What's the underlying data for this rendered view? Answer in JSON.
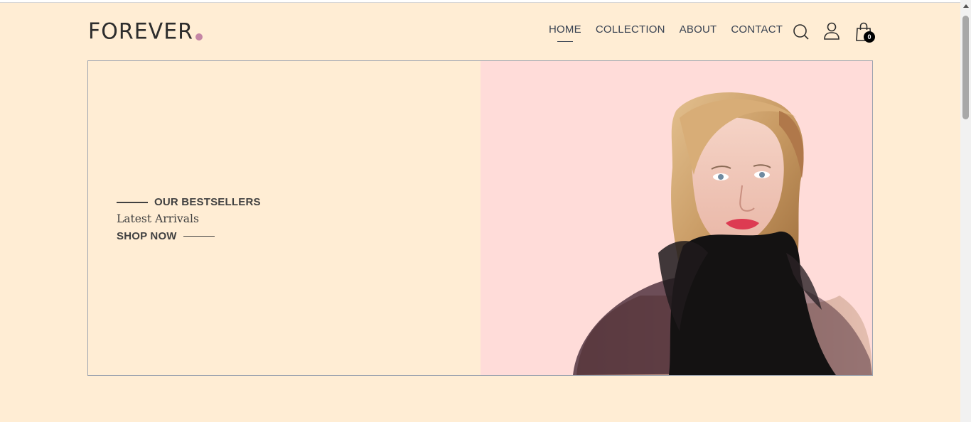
{
  "brand": {
    "logo_text": "FOREVER",
    "dot_color": "#c586a5"
  },
  "nav": {
    "items": [
      {
        "label": "HOME",
        "active": true
      },
      {
        "label": "COLLECTION",
        "active": false
      },
      {
        "label": "ABOUT",
        "active": false
      },
      {
        "label": "CONTACT",
        "active": false
      }
    ]
  },
  "header_icons": {
    "search": "search-icon",
    "profile": "user-icon",
    "cart": "shopping-bag-icon",
    "cart_count": "0"
  },
  "hero": {
    "eyebrow": "OUR BESTSELLERS",
    "title": "Latest Arrivals",
    "cta": "SHOP NOW",
    "image": "model-portrait-black-scarf",
    "bg_left": "#ffedd4",
    "bg_right": "#ffdcd9"
  }
}
